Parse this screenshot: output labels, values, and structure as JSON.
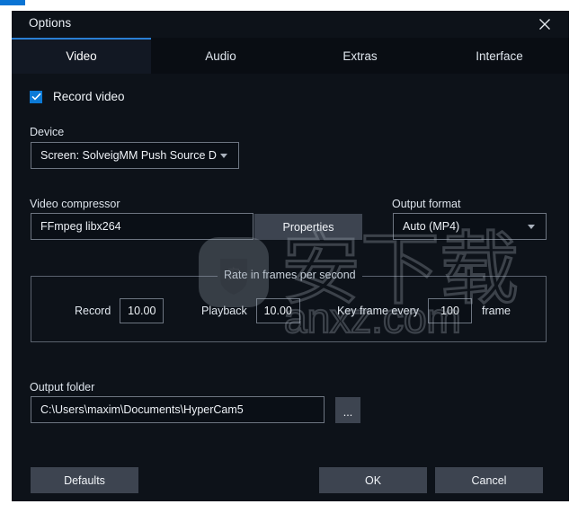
{
  "window": {
    "title": "Options",
    "close_icon": "close-icon"
  },
  "tabs": [
    {
      "label": "Video",
      "active": true
    },
    {
      "label": "Audio",
      "active": false
    },
    {
      "label": "Extras",
      "active": false
    },
    {
      "label": "Interface",
      "active": false
    }
  ],
  "video": {
    "record_video": {
      "label": "Record video",
      "checked": true
    },
    "device": {
      "label": "Device",
      "value": "Screen: SolveigMM Push Source D"
    },
    "video_compressor": {
      "label": "Video compressor",
      "value": "FFmpeg libx264"
    },
    "properties_button": "Properties",
    "output_format": {
      "label": "Output format",
      "value": "Auto (MP4)"
    },
    "rate_group": {
      "legend": "Rate in frames per second",
      "record_label": "Record",
      "record_value": "10.00",
      "playback_label": "Playback",
      "playback_value": "10.00",
      "keyframe_label": "Key frame every",
      "keyframe_value": "100",
      "keyframe_suffix": "frame"
    },
    "output_folder": {
      "label": "Output folder",
      "value": "C:\\Users\\maxim\\Documents\\HyperCam5",
      "browse_button": "..."
    }
  },
  "footer": {
    "defaults": "Defaults",
    "ok": "OK",
    "cancel": "Cancel"
  },
  "watermark": {
    "text_cn": "安下载",
    "text_url": "anxz.com",
    "logo_glyph": "安"
  },
  "colors": {
    "accent": "#2a7fd4",
    "checkbox": "#0c7ad6",
    "dialog_bg": "#0d1219",
    "tabstrip_bg": "#090d13",
    "button_bg": "#3d4450",
    "input_bg": "#0a0f16",
    "border": "#6d7581"
  }
}
